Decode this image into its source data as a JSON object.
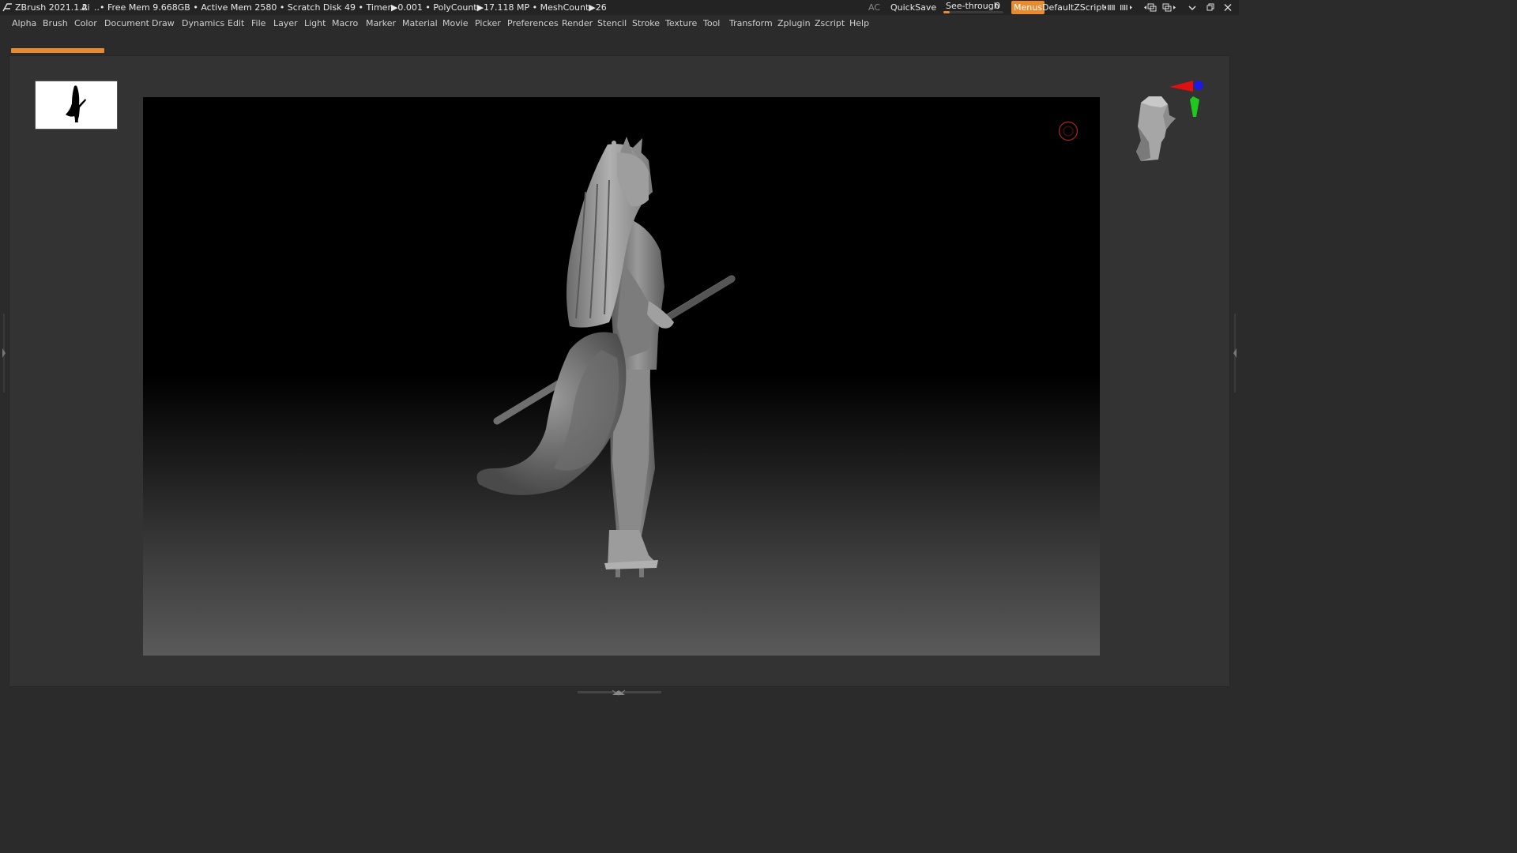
{
  "titlebar": {
    "app_name": "ZBrush 2021.1.2",
    "ai_label": "Ai",
    "stats": "..• Free Mem 9.668GB • Active Mem 2580 • Scratch Disk 49 • Timer▶0.001 • PolyCount▶17.118 MP • MeshCount▶26",
    "ac_label": "AC",
    "quicksave_label": "QuickSave",
    "seethrough_label": "See-through",
    "seethrough_value": "0",
    "seethrough_fraction": 0.1,
    "menus_label": "Menus",
    "script_label": "DefaultZScript",
    "accent_color": "#e98a2e",
    "icons": [
      "layout-prev-icon",
      "layout-next-icon",
      "dock-icon",
      "undock-icon",
      "minimize-icon",
      "restore-icon",
      "close-icon"
    ]
  },
  "menubar": {
    "items": [
      "Alpha",
      "Brush",
      "Color",
      "Document",
      "Draw",
      "Dynamics",
      "Edit",
      "File",
      "Layer",
      "Light",
      "Macro",
      "Marker",
      "Material",
      "Movie",
      "Picker",
      "Preferences",
      "Render",
      "Stencil",
      "Stroke",
      "Texture",
      "Tool",
      "Transform",
      "Zplugin",
      "Zscript",
      "Help"
    ]
  },
  "progress": {
    "color": "#e98a2e"
  },
  "viewport": {
    "subject": "fox-girl-3d-sculpt",
    "background_top": "#000000",
    "background_bottom": "#5a5a5a"
  },
  "navcube": {
    "axis_colors": {
      "x": "#e01010",
      "y": "#1ec81e",
      "z": "#1a1ae0"
    }
  }
}
